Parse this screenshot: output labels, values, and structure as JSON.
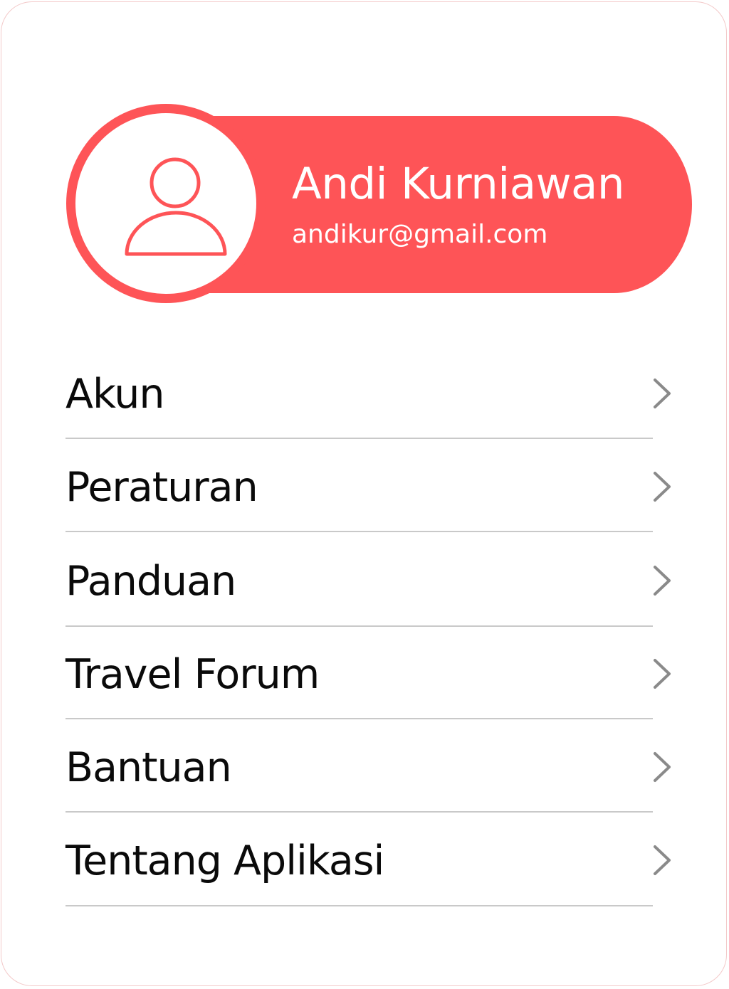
{
  "colors": {
    "accent": "#fe5457",
    "divider": "#c9c9c9",
    "chevron": "#8a8a8a",
    "text": "#0a0a0a"
  },
  "profile": {
    "avatar_icon": "user-icon",
    "name": "Andi Kurniawan",
    "email": "andikur@gmail.com"
  },
  "menu": {
    "chevron_icon": "chevron-right-icon",
    "items": [
      {
        "label": "Akun"
      },
      {
        "label": "Peraturan"
      },
      {
        "label": "Panduan"
      },
      {
        "label": "Travel Forum"
      },
      {
        "label": "Bantuan"
      },
      {
        "label": "Tentang Aplikasi"
      }
    ]
  }
}
